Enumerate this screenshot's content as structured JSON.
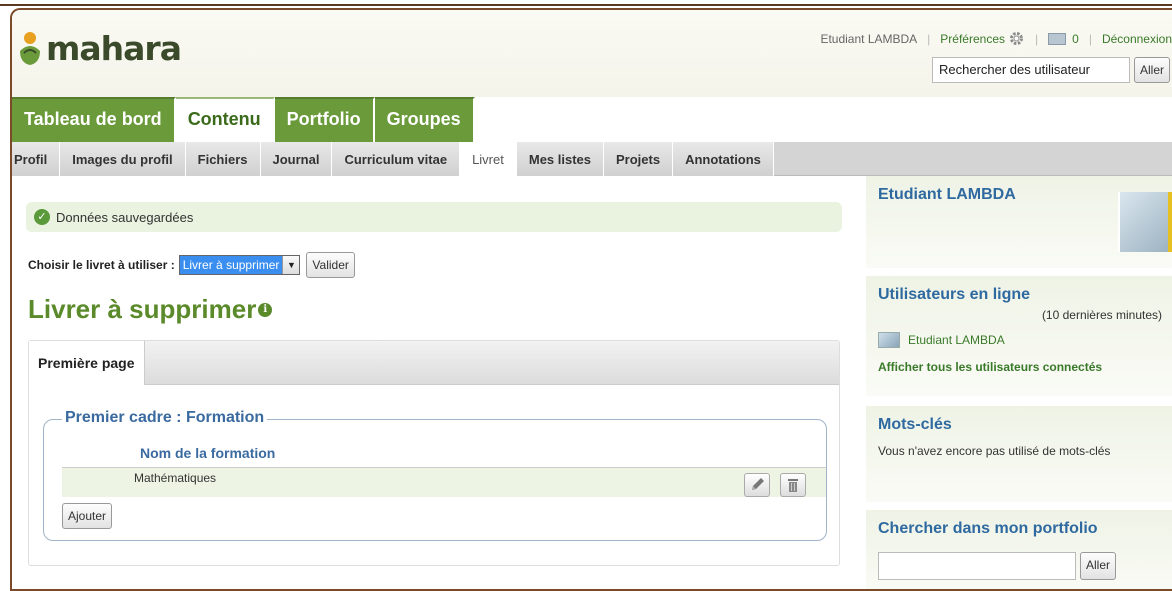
{
  "brand": {
    "name": "mahara"
  },
  "user_nav": {
    "username": "Etudiant LAMBDA",
    "preferences": "Préférences",
    "inbox_count": "0",
    "logout": "Déconnexion"
  },
  "user_search": {
    "value": "Rechercher des utilisateur",
    "button": "Aller"
  },
  "main_tabs": [
    {
      "label": "Tableau de bord"
    },
    {
      "label": "Contenu"
    },
    {
      "label": "Portfolio"
    },
    {
      "label": "Groupes"
    }
  ],
  "sub_tabs": [
    {
      "label": "Profil"
    },
    {
      "label": "Images du profil"
    },
    {
      "label": "Fichiers"
    },
    {
      "label": "Journal"
    },
    {
      "label": "Curriculum vitae"
    },
    {
      "label": "Livret"
    },
    {
      "label": "Mes listes"
    },
    {
      "label": "Projets"
    },
    {
      "label": "Annotations"
    }
  ],
  "message": {
    "success": "Données sauvegardées"
  },
  "chooser": {
    "label": "Choisir le livret à utiliser :",
    "selected": "Livrer à supprimer",
    "button": "Valider"
  },
  "page": {
    "title": "Livrer à supprimer",
    "tab": "Première page",
    "frame_title": "Premier cadre : Formation",
    "column_header": "Nom de la formation",
    "row_value": "Mathématiques",
    "add_button": "Ajouter"
  },
  "sidebar": {
    "profile_name": "Etudiant LAMBDA",
    "online_title": "Utilisateurs en ligne",
    "online_note": "(10 dernières minutes)",
    "online_user": "Etudiant LAMBDA",
    "show_all": "Afficher tous les utilisateurs connectés",
    "tags_title": "Mots-clés",
    "tags_text": "Vous n'avez encore pas utilisé de mots-clés",
    "search_title": "Chercher dans mon portfolio",
    "search_button": "Aller"
  },
  "colors": {
    "green": "#6a9a3a",
    "blue_heading": "#2e6aa0",
    "success_bg": "#e9f3df"
  }
}
